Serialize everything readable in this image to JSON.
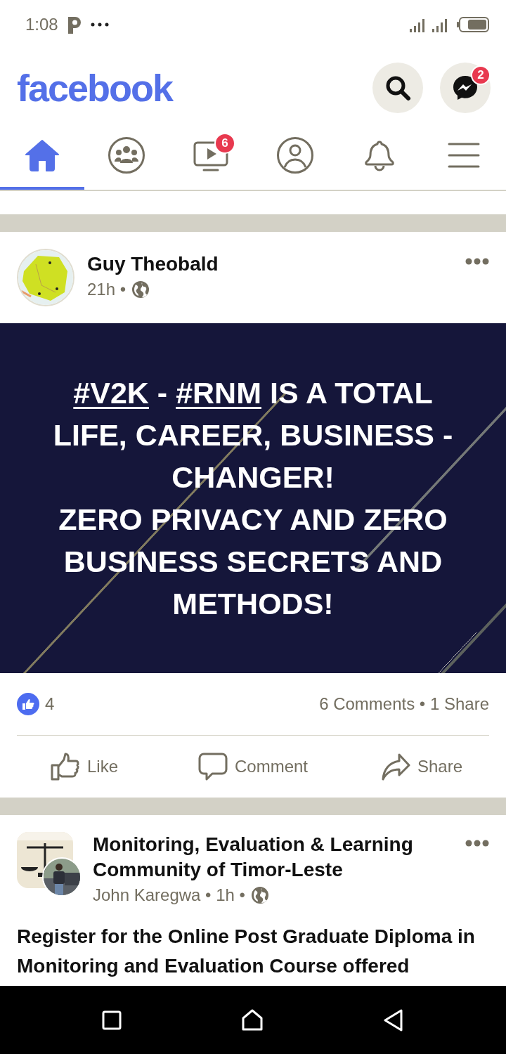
{
  "status_bar": {
    "time": "1:08"
  },
  "header": {
    "logo": "facebook",
    "messenger_badge": "2"
  },
  "tabs": [
    {
      "kind": "home",
      "selected": true
    },
    {
      "kind": "groups",
      "selected": false
    },
    {
      "kind": "watch",
      "selected": false,
      "badge": "6"
    },
    {
      "kind": "profile",
      "selected": false
    },
    {
      "kind": "notifications",
      "selected": false
    },
    {
      "kind": "menu",
      "selected": false
    }
  ],
  "posts": [
    {
      "kind": "image_post",
      "author": "Guy Theobald",
      "meta": "21h •",
      "card_text": [
        {
          "kind": "hashtag",
          "text": "#V2K"
        },
        {
          "kind": "plain",
          "text": " - "
        },
        {
          "kind": "hashtag",
          "text": "#RNM"
        },
        {
          "kind": "plain",
          "text": " IS A TOTAL LIFE, CAREER, BUSINESS - CHANGER!\nZERO PRIVACY AND ZERO BUSINESS SECRETS AND METHODS!"
        }
      ],
      "reactions": "4",
      "counts": "6 Comments • 1 Share",
      "actions": [
        {
          "kind": "like",
          "label": "Like"
        },
        {
          "kind": "comment",
          "label": "Comment"
        },
        {
          "kind": "share",
          "label": "Share"
        }
      ]
    },
    {
      "kind": "group_post",
      "author": "Monitoring, Evaluation & Learning Community of Timor-Leste",
      "meta": "John Karegwa • 1h •",
      "body": "Register for the Online Post Graduate Diploma in Monitoring and Evaluation Course offered"
    }
  ]
}
